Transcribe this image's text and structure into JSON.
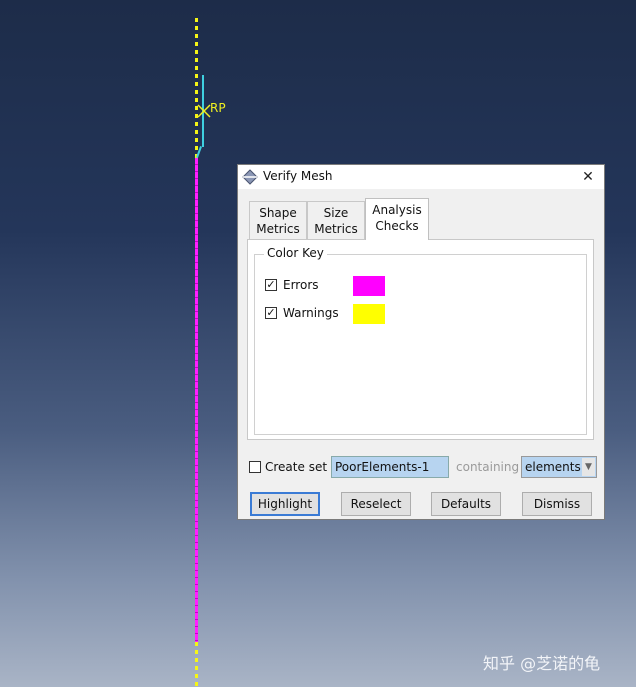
{
  "viewport": {
    "rp_label": "RP",
    "colors": {
      "errors_line": "#ff20ff",
      "free_line": "#f5f516",
      "ref_line": "#3fd0e0"
    }
  },
  "dialog": {
    "title": "Verify Mesh",
    "close_label": "✕",
    "tabs": [
      {
        "line1": "Shape",
        "line2": "Metrics"
      },
      {
        "line1": "Size",
        "line2": "Metrics"
      },
      {
        "line1": "Analysis",
        "line2": "Checks"
      }
    ],
    "color_key": {
      "title": "Color Key",
      "items": [
        {
          "label": "Errors",
          "checked_glyph": "✓",
          "color": "#ff00ff"
        },
        {
          "label": "Warnings",
          "checked_glyph": "✓",
          "color": "#ffff00"
        }
      ]
    },
    "create_set": {
      "label": "Create set",
      "value": "PoorElements-1",
      "containing_label": "containing",
      "selected": "elements"
    },
    "buttons": {
      "highlight": "Highlight",
      "reselect": "Reselect",
      "defaults": "Defaults",
      "dismiss": "Dismiss"
    }
  },
  "watermark": "知乎 @芝诺的龟"
}
